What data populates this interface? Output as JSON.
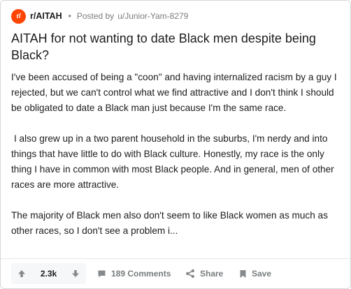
{
  "post": {
    "subreddit_avatar_text": "r/",
    "subreddit": "r/AITAH",
    "separator": "•",
    "posted_by_label": "Posted by",
    "author": "u/Junior-Yam-8279",
    "title": "AITAH for not wanting to date Black men despite being Black?",
    "body": [
      "I've been accused of being a \"coon\" and having internalized racism by a guy I rejected, but we can't control what we find attractive and I don't think I should be obligated to date a Black man just because I'm the same race.",
      "I also grew up in a two parent household in the suburbs, I'm nerdy and into things that have little to do with Black culture. Honestly, my race is the only thing I have in common with most Black people. And in general, men of other races are more attractive.",
      "The majority of Black men also don't seem to like Black women as much as other races, so I don't see a problem i..."
    ]
  },
  "footer": {
    "vote_count": "2.3k",
    "comments_label": "189 Comments",
    "share_label": "Share",
    "save_label": "Save"
  },
  "icons": {
    "upvote": "arrow-up-icon",
    "downvote": "arrow-down-icon",
    "comments": "comment-bubble-icon",
    "share": "share-nodes-icon",
    "save": "bookmark-icon"
  },
  "colors": {
    "subreddit_avatar": "#ff4500",
    "text_primary": "#1c1c1c",
    "text_meta": "#7c7c7c",
    "action_text": "#787c7e",
    "vote_bg": "#f6f7f8",
    "border": "#d7d7d7"
  }
}
